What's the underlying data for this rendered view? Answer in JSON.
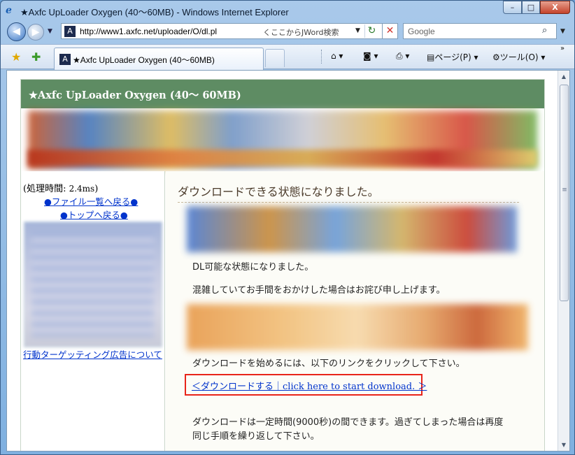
{
  "window": {
    "title": "★Axfc UpLoader Oxygen (40〜60MB) - Windows Internet Explorer",
    "minimize": "–",
    "maximize": "□",
    "close": "X"
  },
  "addressbar": {
    "url": "http://www1.axfc.net/uploader/O/dl.pl",
    "jword": "くここからJWord検索",
    "search_placeholder": "Google"
  },
  "tab": {
    "label": "★Axfc UpLoader Oxygen (40〜60MB)"
  },
  "commands": {
    "page": "ページ(P)",
    "tools": "ツール(O)"
  },
  "page": {
    "header_title": "★Axfc UpLoader Oxygen (40〜 60MB)",
    "sidebar": {
      "proc_time_label": "(処理時間: ",
      "proc_time_value": "2.4ms",
      "proc_time_close": ")",
      "link_file_list": "●ファイル一覧へ戻る●",
      "link_top": "●トップへ戻る●",
      "link_ad_info": "行動ターゲッティング広告について"
    },
    "main": {
      "heading": "ダウンロードできる状態になりました。",
      "line1": "DL可能な状態になりました。",
      "line2": "混雑していてお手間をおかけした場合はお詫び申し上げます。",
      "line3": "ダウンロードを始めるには、以下のリンクをクリックして下さい。",
      "download_link": "＜ダウンロードする｜click here to start download. ＞",
      "line4": "ダウンロードは一定時間(9000秒)の間できます。過ぎてしまった場合は再度",
      "line5": "同じ手順を繰り返して下さい。"
    }
  },
  "colors": {
    "header_bg": "#5e8c63",
    "link": "#0033cc",
    "highlight_border": "#e8241a"
  }
}
